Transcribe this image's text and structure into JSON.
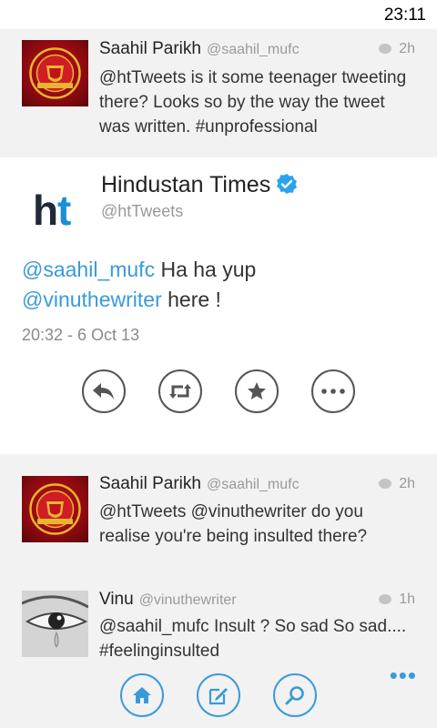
{
  "status_bar": {
    "time": "23:11"
  },
  "tweets": [
    {
      "name": "Saahil Parikh",
      "handle": "@saahil_mufc",
      "time": "2h",
      "text": "@htTweets is it some teenager tweeting there? Looks so by the way the tweet was written. #unprofessional",
      "avatar": "manchester-united-crest"
    },
    {
      "name": "Saahil Parikh",
      "handle": "@saahil_mufc",
      "time": "2h",
      "text": "@htTweets @vinuthewriter do you realise you're being insulted there?",
      "avatar": "manchester-united-crest"
    },
    {
      "name": "Vinu",
      "handle": "@vinuthewriter",
      "time": "1h",
      "text": "@saahil_mufc Insult ? So sad So sad.... #feelinginsulted",
      "avatar": "crying-eye-photo"
    }
  ],
  "detail": {
    "name": "Hindustan Times",
    "handle": "@htTweets",
    "logo_text_dark": "h",
    "logo_text_accent": "t",
    "mention_1": "@saahil_mufc",
    "text_1": " Ha ha yup",
    "mention_2": "@vinuthewriter",
    "text_2": " here !",
    "timestamp": "20:32 - 6 Oct 13",
    "actions": [
      "reply-icon",
      "retweet-icon",
      "favorite-icon",
      "more-icon"
    ]
  },
  "appbar": {
    "buttons": [
      "home-icon",
      "compose-icon",
      "search-icon"
    ],
    "more": "•••"
  },
  "colors": {
    "accent": "#3a9ad9",
    "background": "#f2f2f2",
    "card": "#ffffff",
    "mu_red": "#c1121c"
  }
}
